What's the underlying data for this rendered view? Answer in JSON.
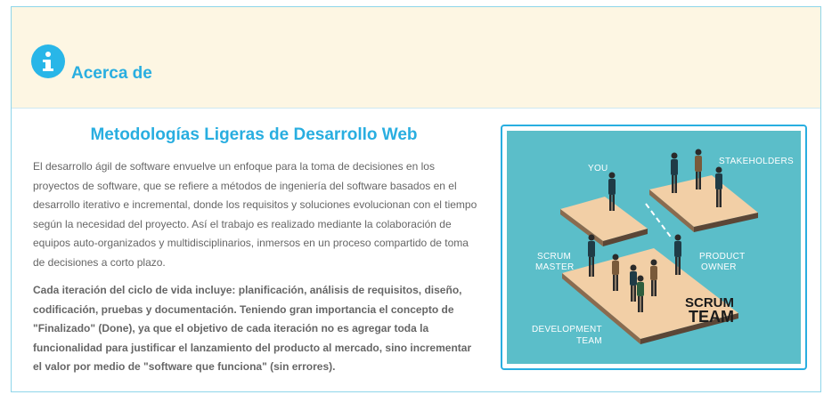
{
  "header": {
    "title": "Acerca de",
    "icon": "info-icon"
  },
  "content": {
    "title": "Metodologías Ligeras de Desarrollo Web",
    "paragraph1": "El desarrollo ágil de software envuelve un enfoque para la toma de decisiones en los proyectos de software, que se refiere a métodos de ingeniería del software basados en el desarrollo iterativo e incremental, donde los requisitos y soluciones evolucionan con el tiempo según la necesidad del proyecto. Así el trabajo es realizado mediante la colaboración de equipos auto-organizados y multidisciplinarios, inmersos en un proceso compartido de toma de decisiones a corto plazo.",
    "paragraph2": "Cada iteración del ciclo de vida incluye: planificación, análisis de requisitos, diseño, codificación, pruebas y documentación. Teniendo gran importancia el concepto de \"Finalizado\" (Done), ya que el objetivo de cada iteración no es agregar toda la funcionalidad para justificar el lanzamiento del producto al mercado, sino incrementar el valor por medio de \"software que funciona\" (sin errores)."
  },
  "illustration": {
    "labels": {
      "you": "YOU",
      "stakeholders": "STAKEHOLDERS",
      "scrum_master_1": "SCRUM",
      "scrum_master_2": "MASTER",
      "product_owner_1": "PRODUCT",
      "product_owner_2": "OWNER",
      "dev_team_1": "DEVELOPMENT",
      "dev_team_2": "TEAM",
      "scrum_team_1": "SCRUM",
      "scrum_team_2": "TEAM"
    }
  },
  "colors": {
    "accent": "#29aee0",
    "header_bg": "#fdf6e3",
    "illustration_bg": "#5bbec9",
    "platform": "#f2cfa6"
  }
}
